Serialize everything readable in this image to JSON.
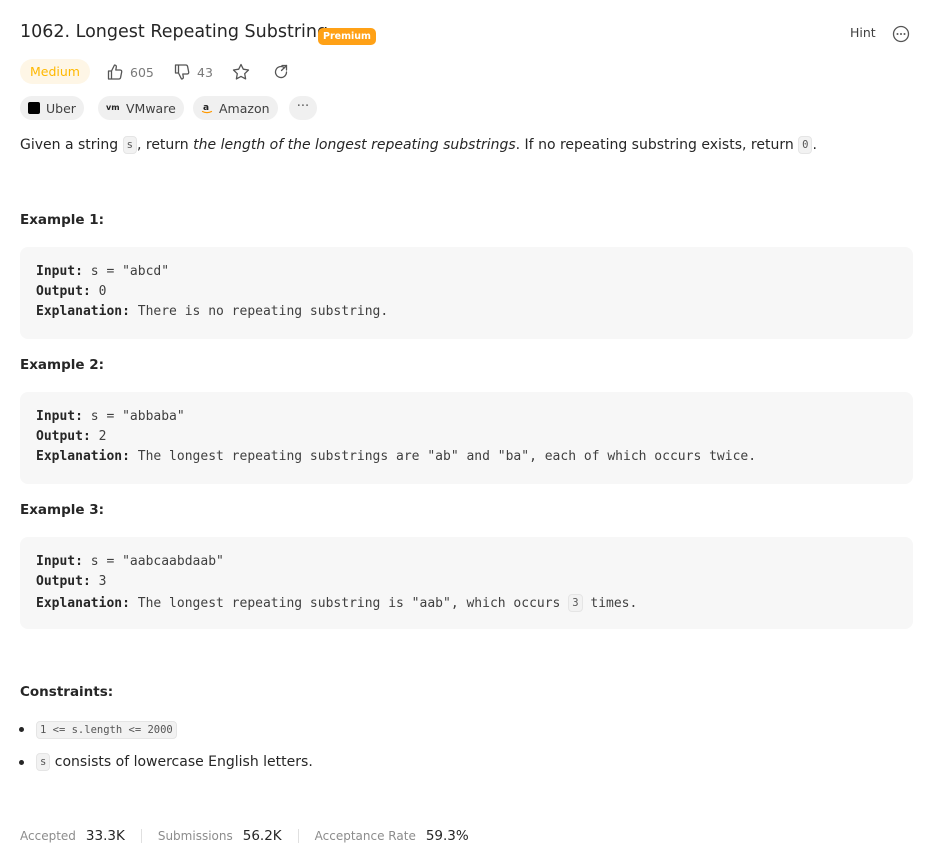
{
  "problem": {
    "title": "1062. Longest Repeating Substring",
    "premium_label": "Premium",
    "hint_label": "Hint",
    "difficulty": "Medium",
    "likes": "605",
    "dislikes": "43"
  },
  "companies": [
    {
      "name": "Uber",
      "icon": "uber-logo"
    },
    {
      "name": "VMware",
      "icon": "vmware-logo"
    },
    {
      "name": "Amazon",
      "icon": "amazon-logo"
    }
  ],
  "more_label": "···",
  "description": {
    "p1": "Given a string ",
    "var_s": "s",
    "p2": ", return ",
    "emph": "the length of the longest repeating substrings",
    "p3": ". If no repeating substring exists, return ",
    "zero": "0",
    "p4": "."
  },
  "examples": [
    {
      "title": "Example 1:",
      "input_label": "Input:",
      "input": " s = \"abcd\"",
      "output_label": "Output:",
      "output": " 0",
      "expl_label": "Explanation:",
      "expl": " There is no repeating substring."
    },
    {
      "title": "Example 2:",
      "input_label": "Input:",
      "input": " s = \"abbaba\"",
      "output_label": "Output:",
      "output": " 2",
      "expl_label": "Explanation:",
      "expl": " The longest repeating substrings are \"ab\" and \"ba\", each of which occurs twice."
    },
    {
      "title": "Example 3:",
      "input_label": "Input:",
      "input": " s = \"aabcaabdaab\"",
      "output_label": "Output:",
      "output": " 3",
      "expl_label": "Explanation:",
      "expl_a": " The longest repeating substring is \"aab\", which occurs ",
      "expl_code": "3",
      "expl_b": " times."
    }
  ],
  "constraints": {
    "title": "Constraints:",
    "c1_code": "1 <= s.length <= 2000",
    "c2_code": "s",
    "c2_text": " consists of lowercase English letters."
  },
  "stats": {
    "accepted_label": "Accepted",
    "accepted": "33.3K",
    "submissions_label": "Submissions",
    "submissions": "56.2K",
    "rate_label": "Acceptance Rate",
    "rate": "59.3%"
  },
  "colors": {
    "premium": "#ffa116",
    "difficulty_text": "#ffb800",
    "difficulty_bg": "#fef6e6"
  }
}
